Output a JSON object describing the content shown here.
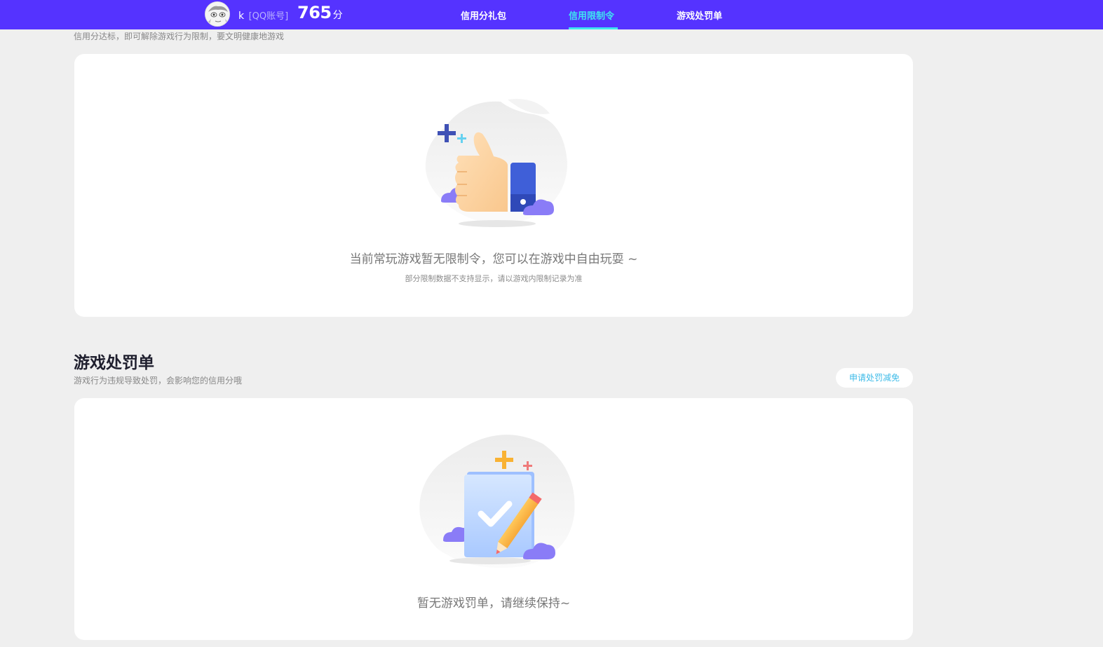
{
  "header": {
    "username": "k",
    "account_type": "[QQ账号]",
    "score": "765",
    "score_unit": "分",
    "tabs": [
      {
        "label": "信用分礼包",
        "active": false
      },
      {
        "label": "信用限制令",
        "active": true
      },
      {
        "label": "游戏处罚单",
        "active": false
      }
    ],
    "accent_color": "#5533ff",
    "active_tab_color": "#3ee6f0"
  },
  "restriction_section": {
    "subtitle": "信用分达标，即可解除游戏行为限制，要文明健康地游戏",
    "empty_main": "当前常玩游戏暂无限制令，您可以在游戏中自由玩耍 ~",
    "empty_sub": "部分限制数据不支持显示，请以游戏内限制记录为准",
    "illustration_icon": "thumbs-up-icon"
  },
  "penalty_section": {
    "title": "游戏处罚单",
    "subtitle": "游戏行为违规导致处罚，会影响您的信用分哦",
    "appeal_button": "申请处罚减免",
    "empty_main": "暂无游戏罚单，请继续保持~",
    "illustration_icon": "clipboard-check-icon"
  }
}
